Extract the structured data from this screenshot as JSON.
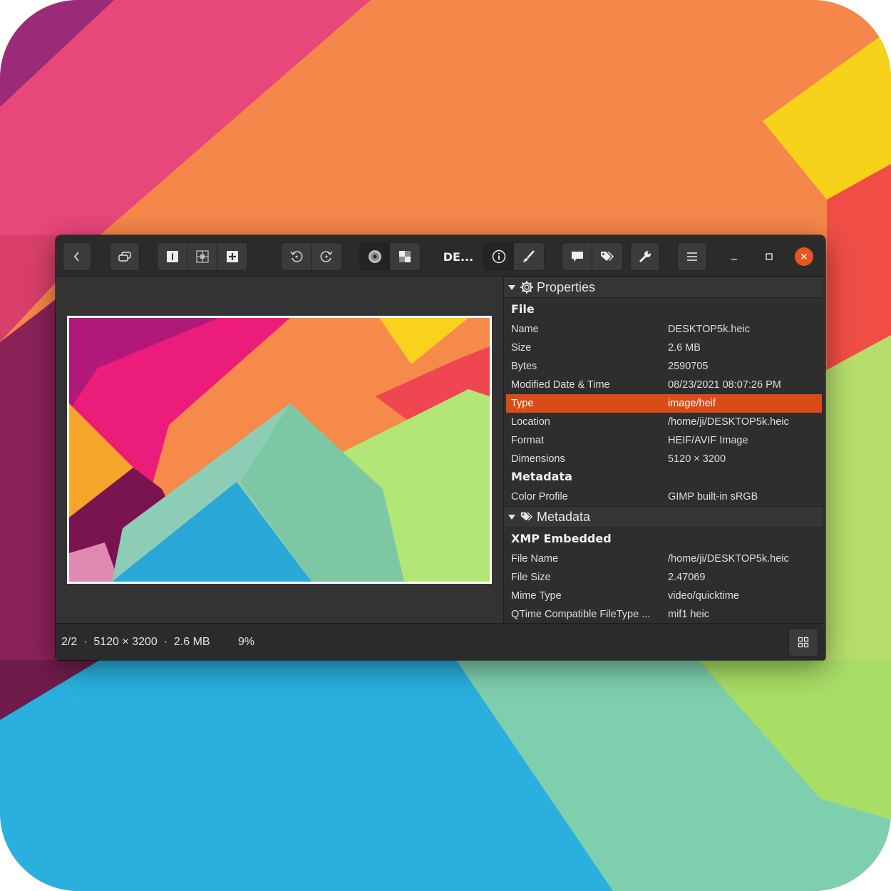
{
  "window": {
    "title": "DE...",
    "colors": {
      "accent": "#e95420",
      "selection": "#d94c18",
      "headerbar": "#2b2b2b",
      "sidebar": "#2e2e2e"
    }
  },
  "toolbar": {
    "buttons": [
      {
        "name": "back",
        "icon": "chevron-left-icon"
      },
      {
        "name": "windowed",
        "icon": "restore-windows-icon"
      },
      {
        "name": "view-single",
        "icon": "single-view-icon"
      },
      {
        "name": "view-grid",
        "icon": "grid-view-icon"
      },
      {
        "name": "add",
        "icon": "plus-box-icon"
      },
      {
        "name": "rotate-left",
        "icon": "rotate-left-icon"
      },
      {
        "name": "rotate-right",
        "icon": "rotate-right-icon"
      },
      {
        "name": "background-dark",
        "icon": "disc-icon"
      },
      {
        "name": "background-checker",
        "icon": "checkerboard-icon"
      },
      {
        "name": "info",
        "icon": "info-icon"
      },
      {
        "name": "edit",
        "icon": "brush-icon"
      },
      {
        "name": "comment",
        "icon": "speech-bubble-icon"
      },
      {
        "name": "tags",
        "icon": "tags-icon"
      },
      {
        "name": "tools",
        "icon": "wrench-icon"
      },
      {
        "name": "menu",
        "icon": "hamburger-menu-icon"
      },
      {
        "name": "minimize",
        "icon": "minimize-icon"
      },
      {
        "name": "maximize",
        "icon": "maximize-icon"
      },
      {
        "name": "close",
        "icon": "close-icon"
      }
    ]
  },
  "sidebar": {
    "properties": {
      "header": "Properties",
      "file_group": "File",
      "rows": [
        {
          "key": "Name",
          "value": "DESKTOP5k.heic"
        },
        {
          "key": "Size",
          "value": "2.6 MB"
        },
        {
          "key": "Bytes",
          "value": "2590705"
        },
        {
          "key": "Modified Date & Time",
          "value": "08/23/2021 08:07:26 PM"
        },
        {
          "key": "Type",
          "value": "image/heif",
          "selected": true
        },
        {
          "key": "Location",
          "value": "/home/ji/DESKTOP5k.heic"
        },
        {
          "key": "Format",
          "value": "HEIF/AVIF Image"
        },
        {
          "key": "Dimensions",
          "value": "5120 × 3200"
        }
      ],
      "metadata_group": "Metadata",
      "metadata_rows": [
        {
          "key": "Color Profile",
          "value": "GIMP built-in sRGB"
        }
      ]
    },
    "metadata": {
      "header": "Metadata",
      "xmp_group": "XMP Embedded",
      "rows": [
        {
          "key": "File Name",
          "value": "/home/ji/DESKTOP5k.heic"
        },
        {
          "key": "File Size",
          "value": "2.47069"
        },
        {
          "key": "Mime Type",
          "value": "video/quicktime"
        },
        {
          "key": "QTime Compatible FileType ...",
          "value": "mif1 heic"
        }
      ]
    }
  },
  "statusbar": {
    "info": "2/2  ·  5120 × 3200  ·  2.6 MB",
    "zoom": "9%",
    "gallery_icon": "gallery-grid-icon"
  }
}
